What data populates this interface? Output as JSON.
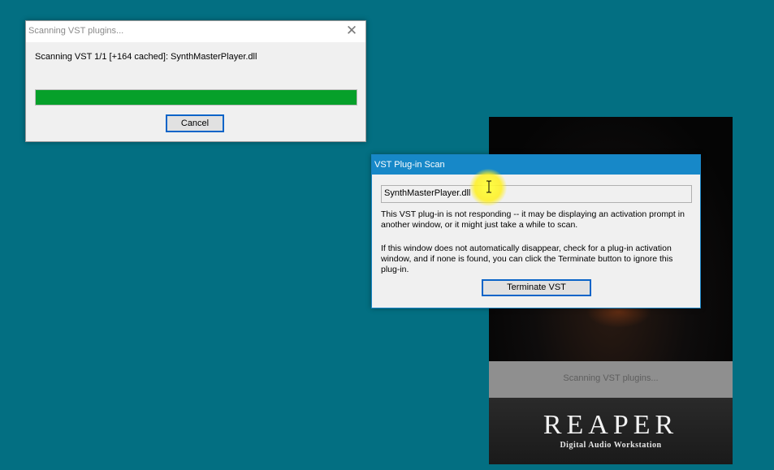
{
  "scan_dialog": {
    "title": "Scanning VST plugins...",
    "status": "Scanning VST 1/1 [+164 cached]: SynthMasterPlayer.dll",
    "progress": 1.0,
    "cancel_label": "Cancel",
    "close_icon": "close-icon"
  },
  "vst_scan_dialog": {
    "title": "VST Plug-in Scan",
    "plugin_name": "SynthMasterPlayer.dll",
    "message_1": "This VST plug-in is not responding -- it may be displaying an activation prompt in another window, or it might just take a while to scan.",
    "message_2": "If this window does not automatically disappear, check for a plug-in activation window, and if none is found, you can click the Terminate button to ignore this plug-in.",
    "terminate_label": "Terminate VST"
  },
  "splash": {
    "status": "Scanning VST plugins...",
    "logo": "REAPER",
    "tagline": "Digital Audio Workstation"
  },
  "colors": {
    "desktop": "#036f82",
    "progress_fill": "#06a02a",
    "titlebar_active": "#1788c8",
    "cursor_highlight": "#ffff3c"
  },
  "cursor": {
    "icon": "text-cursor-icon"
  }
}
